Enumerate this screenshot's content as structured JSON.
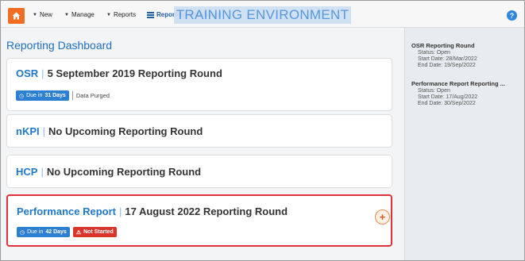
{
  "nav": {
    "new_label": "New",
    "manage_label": "Manage",
    "reports_label": "Reports",
    "reporting_label": "Reporting Dashboard",
    "training_banner": "TRAINING ENVIRONMENT"
  },
  "main": {
    "title": "Reporting Dashboard",
    "cards": [
      {
        "program": "OSR",
        "round": "5 September 2019 Reporting Round",
        "due_prefix": "Due in",
        "due_days": "31 Days",
        "extra": "Data Purged"
      },
      {
        "program": "nKPI",
        "round": "No Upcoming Reporting Round"
      },
      {
        "program": "HCP",
        "round": "No Upcoming Reporting Round"
      },
      {
        "program": "Performance Report",
        "round": "17 August 2022 Reporting Round",
        "due_prefix": "Due in",
        "due_days": "42 Days",
        "status": "Not Started"
      }
    ]
  },
  "sidebar": {
    "rounds": [
      {
        "title": "OSR Reporting Round",
        "status": "Status: Open",
        "start": "Start Date: 28/Mar/2022",
        "end": "End Date: 19/Sep/2022"
      },
      {
        "title": "Performance Report Reporting ...",
        "status": "Status: Open",
        "start": "Start Date: 17/Aug/2022",
        "end": "End Date: 30/Sep/2022"
      }
    ]
  },
  "colors": {
    "accent": "#1f78c8",
    "home": "#f26d21",
    "highlight": "#e0303a",
    "due_badge": "#2c7fd1",
    "status_badge": "#d9352b"
  },
  "icons": [
    "home-icon",
    "clock-icon",
    "alert-icon",
    "plus-icon",
    "help-icon",
    "dashboard-icon"
  ]
}
